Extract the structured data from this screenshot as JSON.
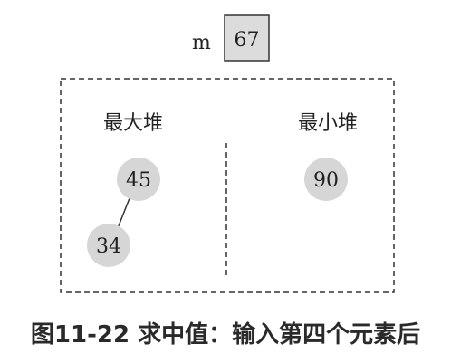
{
  "median": {
    "label": "m",
    "value": "67"
  },
  "max_heap": {
    "title": "最大堆",
    "nodes": [
      "45",
      "34"
    ]
  },
  "min_heap": {
    "title": "最小堆",
    "nodes": [
      "90"
    ]
  },
  "caption": "图11-22 求中值：输入第四个元素后",
  "colors": {
    "node_fill": "#d6d6d6",
    "box_fill": "#dcdcdc",
    "stroke": "#333333"
  }
}
